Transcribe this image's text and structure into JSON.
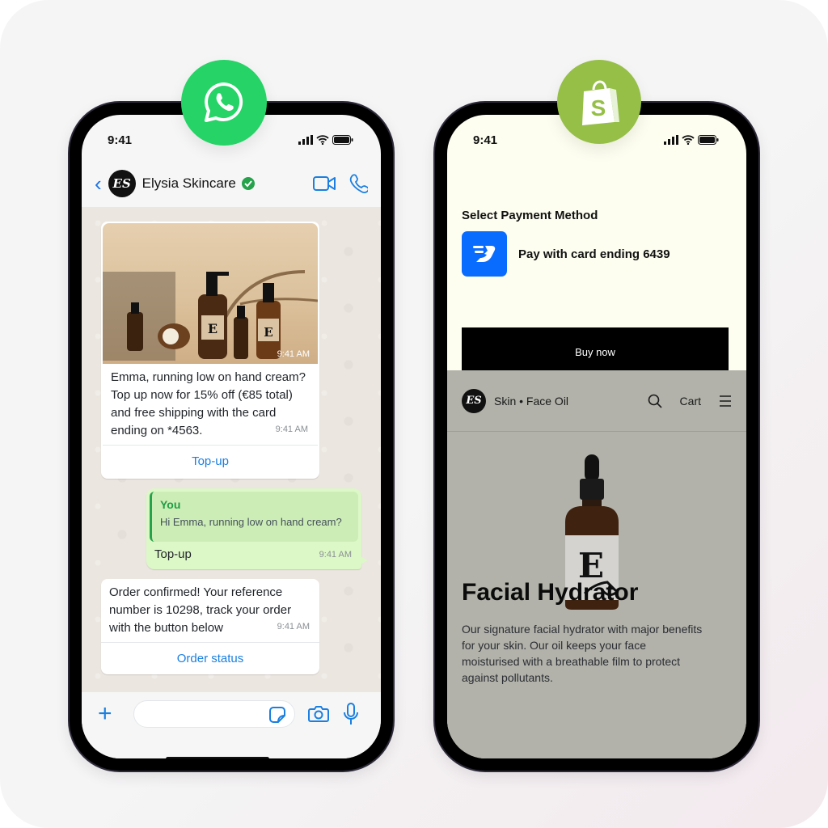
{
  "whatsapp_phone": {
    "status_bar": {
      "time": "9:41"
    },
    "header": {
      "avatar_initials": "ES",
      "contact_name": "Elysia Skincare",
      "verified": true
    },
    "messages": [
      {
        "type": "incoming-media",
        "image_timestamp": "9:41 AM",
        "text": "Emma, running low on hand cream? Top up now for 15% off (€85 total) and free shipping with the card ending on *4563.",
        "time": "9:41 AM",
        "button": "Top-up"
      },
      {
        "type": "outgoing-reply",
        "quote_author": "You",
        "quote_text": "Hi Emma, running low on hand cream?",
        "text": "Top-up",
        "time": "9:41 AM"
      },
      {
        "type": "incoming",
        "text": "Order confirmed! Your reference number is 10298, track your order with the button below",
        "time": "9:41 AM",
        "button": "Order status"
      }
    ],
    "composer": {
      "placeholder": ""
    }
  },
  "shopify_phone": {
    "status_bar": {
      "time": "9:41"
    },
    "payment": {
      "title": "Select Payment Method",
      "method_label": "Pay with card ending 6439",
      "buy_button": "Buy now"
    },
    "store": {
      "avatar_initials": "ES",
      "breadcrumb": "Skin • Face Oil",
      "cart_label": "Cart",
      "product_title": "Facial Hydrator",
      "product_description": "Our signature facial hydrator with major benefits for your skin. Our oil keeps your face moisturised with a breathable film to protect against pollutants."
    }
  },
  "colors": {
    "whatsapp_green": "#25d366",
    "shopify_green": "#95bf47",
    "link_blue": "#1a7fe0",
    "pay_blue": "#0a6cff",
    "outgoing_bubble": "#dcf8c6",
    "store_bg": "#b2b2aa",
    "checkout_bg": "#fdfdf0"
  }
}
